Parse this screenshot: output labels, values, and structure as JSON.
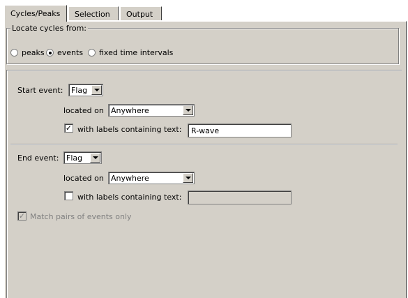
{
  "tabs": [
    {
      "label": "Cycles/Peaks",
      "active": true
    },
    {
      "label": "Selection",
      "active": false
    },
    {
      "label": "Output",
      "active": false
    }
  ],
  "locate_group": {
    "legend": "Locate cycles from:",
    "options": [
      {
        "label": "peaks",
        "checked": false
      },
      {
        "label": "events",
        "checked": true
      },
      {
        "label": "fixed time intervals",
        "checked": false
      }
    ]
  },
  "start_event": {
    "label": "Start event:",
    "type_value": "Flag",
    "located_on_label": "located on",
    "located_on_value": "Anywhere",
    "labels_checkbox": {
      "label": "with labels containing text:",
      "checked": true
    },
    "labels_text": "R-wave"
  },
  "end_event": {
    "label": "End event:",
    "type_value": "Flag",
    "located_on_label": "located on",
    "located_on_value": "Anywhere",
    "labels_checkbox": {
      "label": "with labels containing text:",
      "checked": false
    },
    "labels_text": ""
  },
  "match_pairs": {
    "label": "Match pairs of events only",
    "checked": true,
    "enabled": false
  },
  "icons": {
    "check_glyph": "✓"
  }
}
